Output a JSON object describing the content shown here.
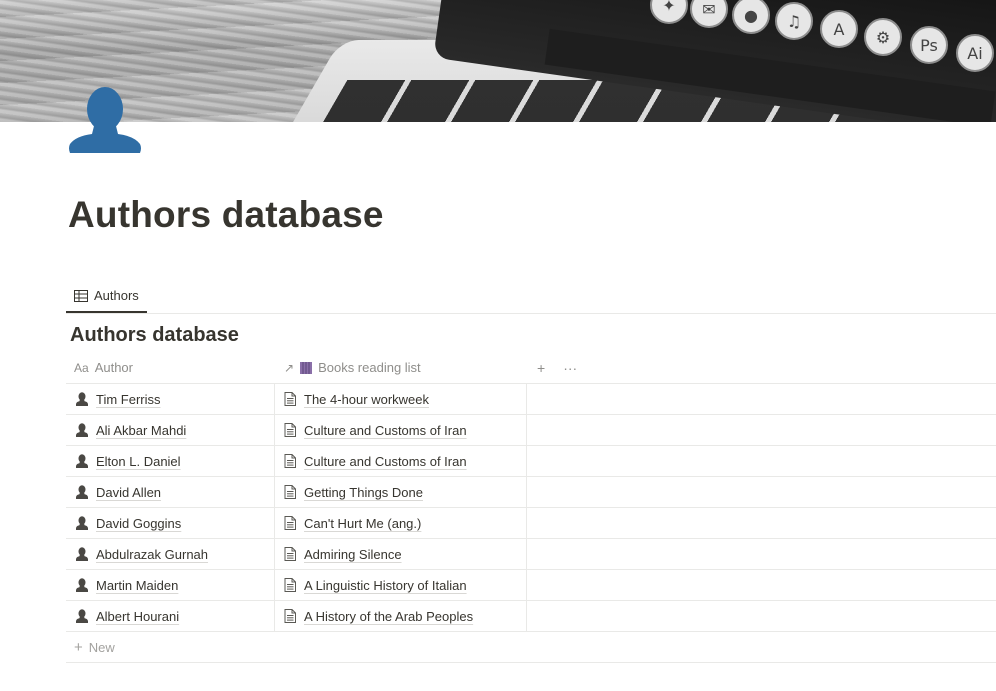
{
  "cover": {
    "dock_icons": [
      "compass-icon",
      "mail-icon",
      "messages-icon",
      "music-icon",
      "app-store-icon",
      "settings-icon",
      "photoshop-icon",
      "illustrator-icon"
    ],
    "ps_label": "Ps",
    "ai_label": "Ai"
  },
  "page": {
    "icon": "person-icon",
    "title": "Authors database"
  },
  "view_tabs": [
    {
      "icon": "table-icon",
      "label": "Authors"
    }
  ],
  "database": {
    "title": "Authors database",
    "columns": [
      {
        "icon_text": "Aa",
        "label": "Author"
      },
      {
        "icon_text": "↗",
        "label": "Books reading list"
      }
    ],
    "add_column": "+",
    "more": "···",
    "rows": [
      {
        "author": "Tim Ferriss",
        "book": "The 4-hour workweek"
      },
      {
        "author": "Ali Akbar Mahdi",
        "book": "Culture and Customs of Iran"
      },
      {
        "author": "Elton L. Daniel",
        "book": "Culture and Customs of Iran"
      },
      {
        "author": "David Allen",
        "book": "Getting Things Done"
      },
      {
        "author": "David Goggins",
        "book": "Can't Hurt Me (ang.)"
      },
      {
        "author": "Abdulrazak Gurnah",
        "book": "Admiring Silence"
      },
      {
        "author": "Martin Maiden",
        "book": "A Linguistic History of Italian"
      },
      {
        "author": "Albert Hourani",
        "book": "A History of the Arab Peoples"
      }
    ],
    "new_label": "New"
  },
  "colors": {
    "text": "#37352f",
    "muted": "#8f8e8b",
    "border": "#e9e9e7",
    "avatar": "#2f6da5"
  }
}
